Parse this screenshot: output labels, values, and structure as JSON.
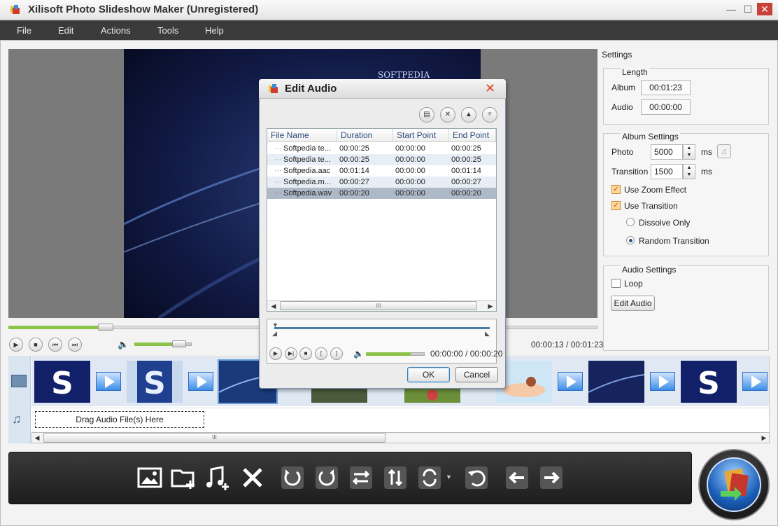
{
  "window": {
    "title": "Xilisoft Photo Slideshow Maker (Unregistered)",
    "min_glyph": "—",
    "max_glyph": "☐",
    "close_glyph": "✕"
  },
  "menu": [
    "File",
    "Edit",
    "Actions",
    "Tools",
    "Help"
  ],
  "preview": {
    "watermark": "SOFTPEDIA",
    "time": "00:00:13 / 00:01:23",
    "seek_progress": 0.165,
    "volume_level": 0.78
  },
  "settings": {
    "title": "Settings",
    "length": {
      "legend": "Length",
      "album_label": "Album",
      "album_value": "00:01:23",
      "audio_label": "Audio",
      "audio_value": "00:00:00"
    },
    "album_settings": {
      "legend": "Album Settings",
      "photo_label": "Photo",
      "photo_value": "5000",
      "photo_unit": "ms",
      "transition_label": "Transition",
      "transition_value": "1500",
      "transition_unit": "ms",
      "zoom_label": "Use Zoom Effect",
      "zoom_checked": true,
      "use_transition_label": "Use Transition",
      "use_transition_checked": true,
      "dissolve_label": "Dissolve Only",
      "random_label": "Random Transition",
      "selected_transition": "Random Transition"
    },
    "audio_settings": {
      "legend": "Audio Settings",
      "loop_label": "Loop",
      "loop_checked": false,
      "edit_audio_button": "Edit Audio"
    }
  },
  "timeline": {
    "drag_audio_hint": "Drag Audio File(s) Here",
    "scroll_grip": "III"
  },
  "dialog": {
    "title": "Edit Audio",
    "columns": [
      "File Name",
      "Duration",
      "Start Point",
      "End Point"
    ],
    "rows": [
      {
        "name": "Softpedia te...",
        "duration": "00:00:25",
        "start": "00:00:00",
        "end": "00:00:25"
      },
      {
        "name": "Softpedia te...",
        "duration": "00:00:25",
        "start": "00:00:00",
        "end": "00:00:25"
      },
      {
        "name": "Softpedia.aac",
        "duration": "00:01:14",
        "start": "00:00:00",
        "end": "00:01:14"
      },
      {
        "name": "Softpedia.m...",
        "duration": "00:00:27",
        "start": "00:00:00",
        "end": "00:00:27"
      },
      {
        "name": "Softpedia.wav",
        "duration": "00:00:20",
        "start": "00:00:00",
        "end": "00:00:20"
      }
    ],
    "selected_row": 4,
    "player_time": "00:00:00 / 00:00:20",
    "player_volume_level": 0.76,
    "ok_label": "OK",
    "cancel_label": "Cancel",
    "scroll_grip": "III"
  },
  "colors": {
    "menubar": "#3b3b3b",
    "accent_green": "#8bc34a",
    "toolbar": "#2a2a2a",
    "selection": "#aeb9c8"
  }
}
